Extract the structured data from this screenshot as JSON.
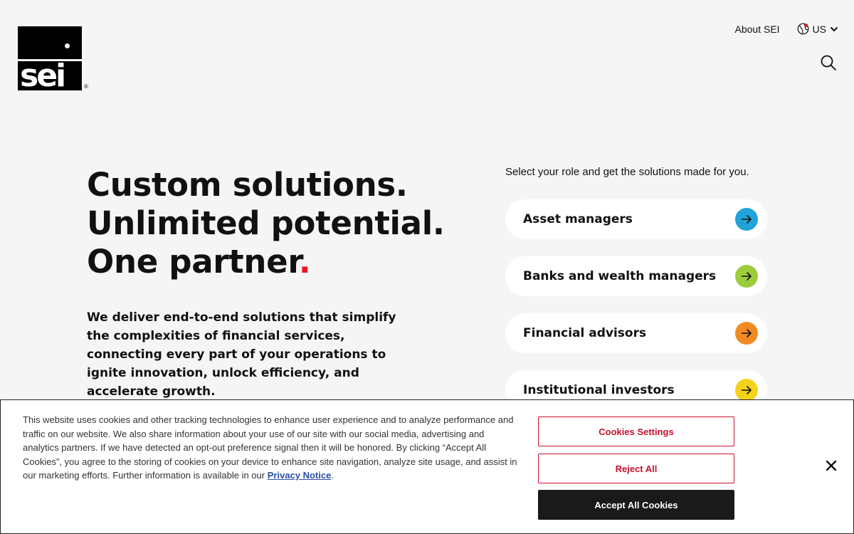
{
  "brand": {
    "logo_text": "sei",
    "registered_mark": "®"
  },
  "nav": {
    "about_label": "About SEI",
    "region_label": "US"
  },
  "hero": {
    "title_lines": [
      "Custom solutions.",
      "Unlimited potential.",
      "One partner"
    ],
    "title_dot": ".",
    "description": "We deliver end-to-end solutions that simplify the complexities of financial services, connecting every part of your operations to ignite innovation, unlock efficiency, and accelerate growth."
  },
  "roles": {
    "prompt": "Select your role and get the solutions made for you.",
    "items": [
      {
        "label": "Asset managers",
        "color": "#1fa3d8"
      },
      {
        "label": "Banks and wealth managers",
        "color": "#9ccc3c"
      },
      {
        "label": "Financial advisors",
        "color": "#f28a22"
      },
      {
        "label": "Institutional investors",
        "color": "#f5d21a"
      }
    ]
  },
  "cookie": {
    "text": "This website uses cookies and other tracking technologies to enhance user experience and to analyze performance and traffic on our website. We also share information about your use of our site with our social media, advertising and analytics partners. If we have detected an opt-out preference signal then it will be honored. By clicking “Accept All Cookies”, you agree to the storing of cookies on your device to enhance site navigation, analyze site usage, and assist in our marketing efforts. Further information is available in our ",
    "privacy_link": "Privacy Notice",
    "text_end": ".",
    "settings_label": "Cookies Settings",
    "reject_label": "Reject All",
    "accept_label": "Accept All Cookies"
  },
  "icons": {
    "region": "globe-icon",
    "region_chevron": "chevron-down-icon",
    "search": "search-icon",
    "role_arrow": "arrow-right-icon",
    "close": "close-icon"
  },
  "colors": {
    "accent_red": "#e41b23",
    "cookie_button_red": "#c8102e",
    "background": "#f5f5f5"
  }
}
